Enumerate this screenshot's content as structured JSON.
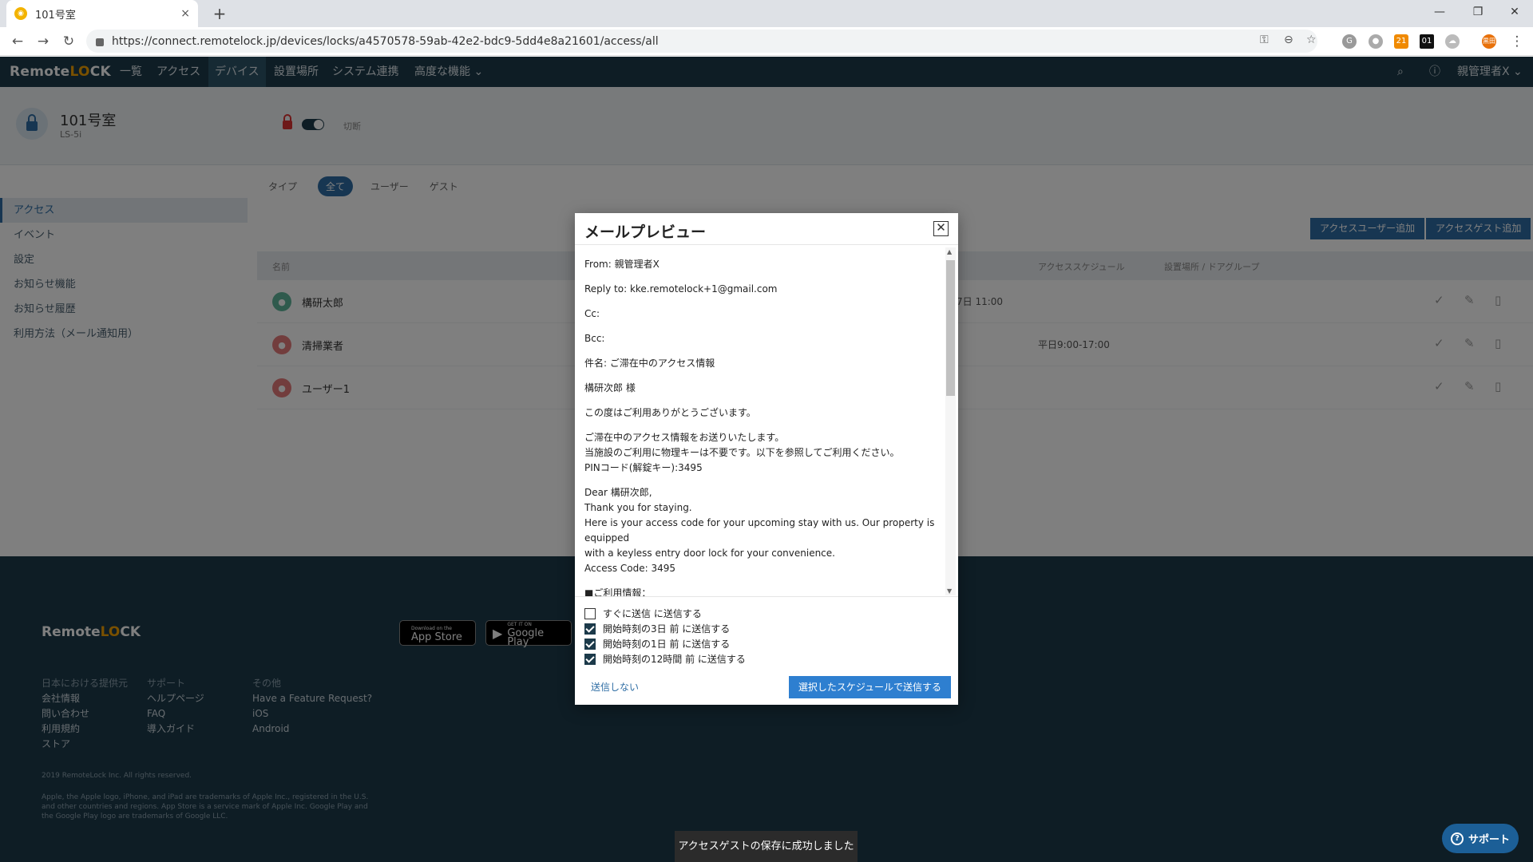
{
  "browser": {
    "tab_title": "101号室",
    "tab_close": "×",
    "new_tab": "+",
    "url": "https://connect.remotelock.jp/devices/locks/a4570578-59ab-42e2-bdc9-5dd4e8a21601/access/all",
    "ext_badge": "21",
    "ext_counter": "01",
    "ext_profile": "黒田"
  },
  "app": {
    "brand_pre": "Remote",
    "brand_o": "LO",
    "brand_post": "CK",
    "nav": [
      "一覧",
      "アクセス",
      "デバイス",
      "設置場所",
      "システム連携",
      "高度な機能 ⌄"
    ],
    "user": "親管理者X ⌄"
  },
  "device": {
    "name": "101号室",
    "model": "LS-5i",
    "toggle_label": "切断"
  },
  "sidebar": [
    "アクセス",
    "イベント",
    "設定",
    "お知らせ機能",
    "お知らせ履歴",
    "利用方法（メール通知用）"
  ],
  "filters": {
    "type_label": "タイプ",
    "all": "全て",
    "user": "ユーザー",
    "guest": "ゲスト"
  },
  "buttons": {
    "add_user": "アクセスユーザー追加",
    "add_guest": "アクセスゲスト追加"
  },
  "table": {
    "col_name": "名前",
    "col_schedule": "アクセススケジュール",
    "col_location": "設置場所 / ドアグループ",
    "rows": [
      {
        "name": "構研太郎",
        "period": "7日 11:00",
        "schedule": ""
      },
      {
        "name": "清掃業者",
        "period": "",
        "schedule": "平日9:00-17:00"
      },
      {
        "name": "ユーザー1",
        "period": "",
        "schedule": ""
      }
    ]
  },
  "modal": {
    "title": "メールプレビュー",
    "from": "From: 親管理者X",
    "reply_to": "Reply to: kke.remotelock+1@gmail.com",
    "cc": "Cc:",
    "bcc": "Bcc:",
    "subject": "件名: ご滞在中のアクセス情報",
    "salutation": "構研次郎 様",
    "thanks": "この度はご利用ありがとうございます。",
    "body_jp": [
      "ご滞在中のアクセス情報をお送りいたします。",
      "当施設のご利用に物理キーは不要です。以下を参照してご利用ください。",
      "PINコード(解錠キー):3495"
    ],
    "body_en": [
      "Dear 構研次郎,",
      "Thank you for staying.",
      "Here is your access code for your upcoming stay with us. Our property is equipped",
      "with a keyless entry door lock for your convenience.",
      "Access Code: 3495"
    ],
    "usage": "■ご利用情報：",
    "options": [
      {
        "label": "すぐに送信 に送信する",
        "checked": false
      },
      {
        "label": "開始時刻の3日 前 に送信する",
        "checked": true
      },
      {
        "label": "開始時刻の1日 前 に送信する",
        "checked": true
      },
      {
        "label": "開始時刻の12時間 前 に送信する",
        "checked": true
      }
    ],
    "cancel": "送信しない",
    "submit": "選択したスケジュールで送信する"
  },
  "footer": {
    "app_store_small": "Download on the",
    "app_store": "App Store",
    "google_play_small": "GET IT ON",
    "google_play": "Google Play",
    "col1_head": "日本における提供元",
    "col1": [
      "会社情報",
      "問い合わせ",
      "利用規約",
      "ストア"
    ],
    "col2_head": "サポート",
    "col2": [
      "ヘルプページ",
      "FAQ",
      "導入ガイド"
    ],
    "col3_head": "その他",
    "col3": [
      "Have a Feature Request?",
      "iOS",
      "Android"
    ],
    "copyright": "2019 RemoteLock Inc. All rights reserved.",
    "legal": "Apple, the Apple logo, iPhone, and iPad are trademarks of Apple Inc., registered in the U.S. and other countries and regions. App Store is a service mark of Apple Inc. Google Play and the Google Play logo are trademarks of Google LLC."
  },
  "toast": "アクセスゲストの保存に成功しました",
  "support": "サポート"
}
